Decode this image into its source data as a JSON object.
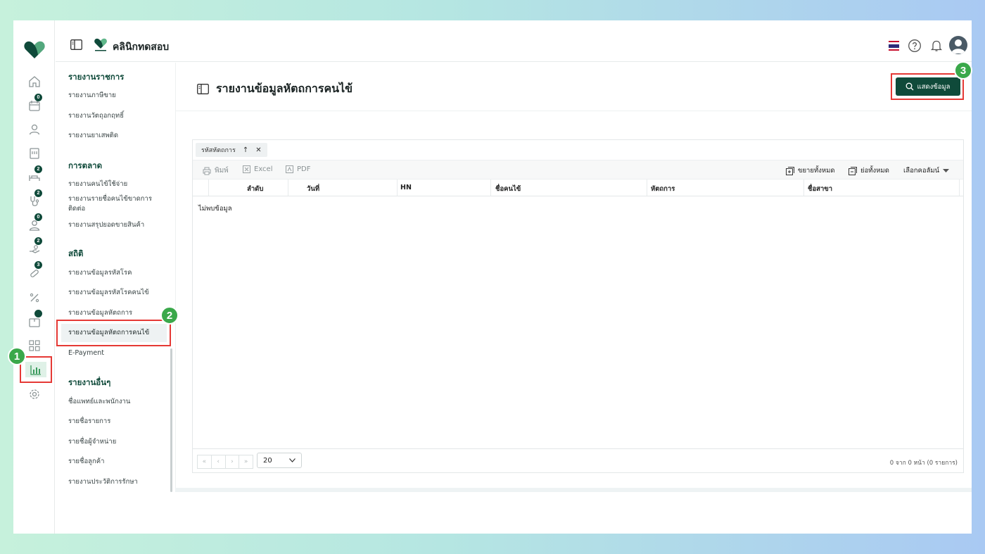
{
  "header": {
    "clinic_name": "คลินิกทดสอบ",
    "colors": {
      "brand": "#0f4a3a",
      "highlight": "#e53935",
      "step": "#3aa84a"
    }
  },
  "rail": {
    "badges": [
      "0",
      "2",
      "2",
      "0",
      "2",
      "3",
      ""
    ],
    "steps": [
      "1"
    ]
  },
  "menu": {
    "sections": [
      {
        "title": "รายงานราชการ",
        "items": [
          "รายงานภาษีขาย",
          "รายงานวัตถุอกฤทธิ์",
          "รายงานยาเสพติด"
        ]
      },
      {
        "title": "การตลาด",
        "items": [
          "รายงานคนไข้ใช้จ่าย",
          "รายงานรายชื่อคนไข้ขาดการติดต่อ",
          "รายงานสรุปยอดขายสินค้า"
        ]
      },
      {
        "title": "สถิติ",
        "items": [
          "รายงานข้อมูลรหัสโรค",
          "รายงานข้อมูลรหัสโรคคนไข้",
          "รายงานข้อมูลหัตถการ",
          "รายงานข้อมูลหัตถการคนไข้",
          "E-Payment"
        ]
      },
      {
        "title": "รายงานอื่นๆ",
        "items": [
          "ชื่อแพทย์และพนักงาน",
          "รายชื่อรายการ",
          "รายชื่อผู้จำหน่าย",
          "รายชื่อลูกค้า",
          "รายงานประวัติการรักษา"
        ]
      }
    ],
    "step": "2"
  },
  "page": {
    "title": "รายงานข้อมูลหัตถการคนไข้",
    "show_button": "แสดงข้อมูล",
    "step": "3"
  },
  "grid": {
    "group_chip": "รหัสหัตถการ",
    "toolbar": {
      "print": "พิมพ์",
      "excel": "Excel",
      "pdf": "PDF",
      "expand_all": "ขยายทั้งหมด",
      "collapse_all": "ย่อทั้งหมด",
      "choose_columns": "เลือกคอลัมน์"
    },
    "columns": [
      "ลำดับ",
      "วันที่",
      "HN",
      "ชื่อคนไข้",
      "หัตถการ",
      "ชื่อสาขา"
    ],
    "empty_text": "ไม่พบข้อมูล",
    "pager": {
      "buttons": [
        "«",
        "‹",
        "›",
        "»"
      ],
      "page_size": "20",
      "info": "0 จาก 0 หน้า (0 รายการ)"
    }
  }
}
